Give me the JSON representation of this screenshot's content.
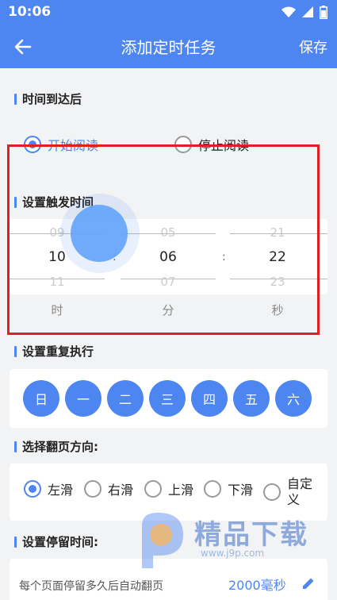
{
  "status_bar": {
    "time": "10:06"
  },
  "app_bar": {
    "title": "添加定时任务",
    "save_label": "保存"
  },
  "trigger": {
    "title": "时间到达后",
    "options": [
      {
        "label": "开始阅读",
        "checked": true
      },
      {
        "label": "停止阅读",
        "checked": false
      }
    ]
  },
  "time_picker": {
    "title": "设置触发时间",
    "separator": ":",
    "hour": {
      "prev": "09",
      "value": "10",
      "next": "11",
      "unit": "时"
    },
    "minute": {
      "prev": "05",
      "value": "06",
      "next": "07",
      "unit": "分"
    },
    "second": {
      "prev": "21",
      "value": "22",
      "next": "23",
      "unit": "秒"
    }
  },
  "repeat": {
    "title": "设置重复执行",
    "days": [
      "日",
      "一",
      "二",
      "三",
      "四",
      "五",
      "六"
    ]
  },
  "direction": {
    "title": "选择翻页方向:",
    "options": [
      {
        "label": "左滑",
        "checked": true
      },
      {
        "label": "右滑",
        "checked": false
      },
      {
        "label": "上滑",
        "checked": false
      },
      {
        "label": "下滑",
        "checked": false
      },
      {
        "label": "自定\n义",
        "checked": false
      }
    ]
  },
  "stay": {
    "title": "设置停留时间:",
    "description": "每个页面停留多久后自动翻页",
    "value": "2000毫秒"
  },
  "watermark": {
    "text": "精品下载",
    "url": "www.j9p.com"
  },
  "colors": {
    "primary": "#4d86f1",
    "highlight": "#e02020"
  }
}
